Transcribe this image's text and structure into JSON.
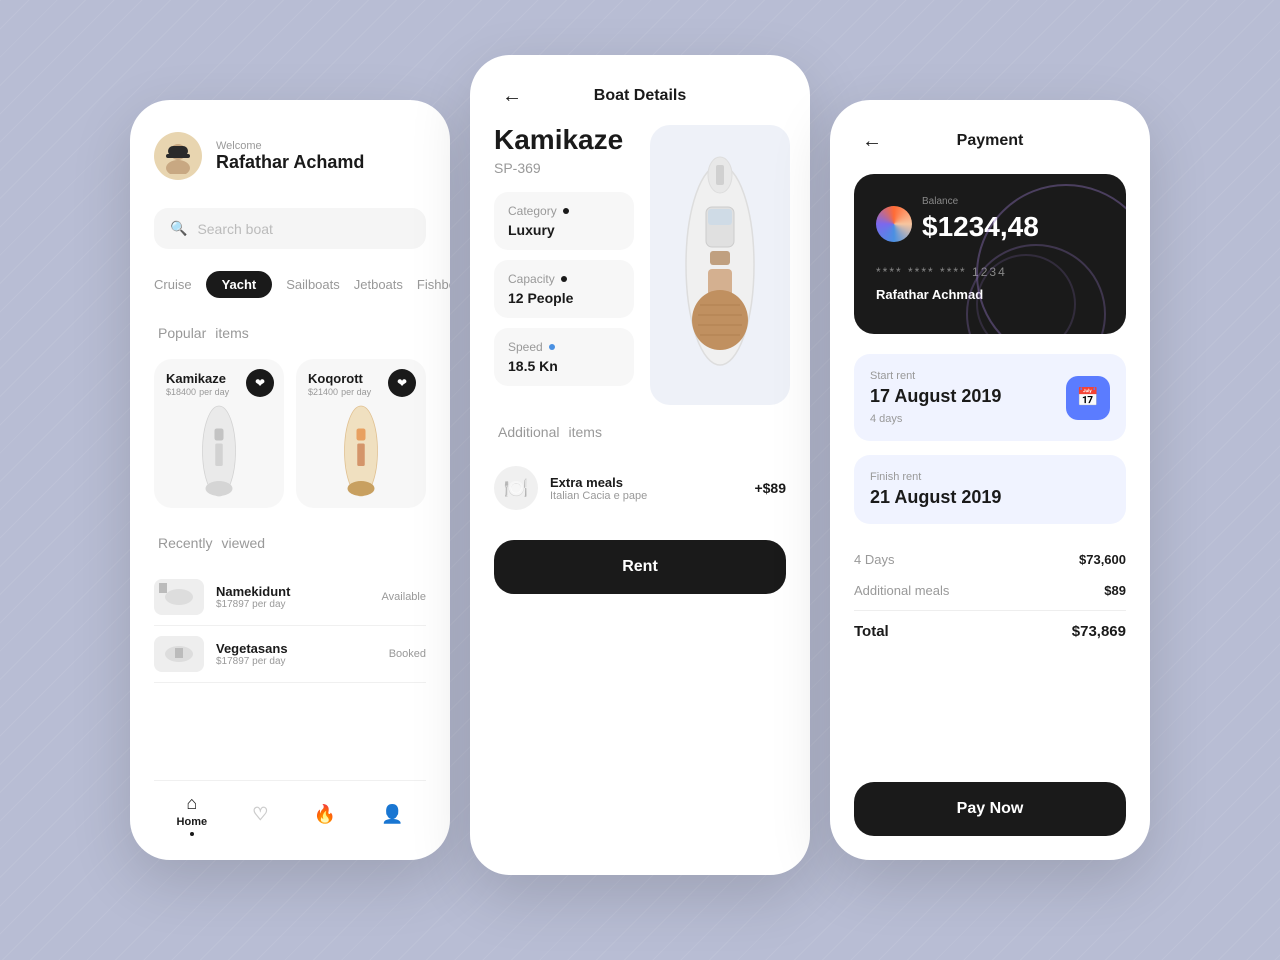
{
  "background": {
    "color": "#b8bdd4"
  },
  "screen1": {
    "header": {
      "welcome_label": "Welcome",
      "user_name": "Rafathar Achamd"
    },
    "search": {
      "placeholder": "Search boat"
    },
    "tabs": [
      {
        "label": "Cruise",
        "active": false
      },
      {
        "label": "Yacht",
        "active": true
      },
      {
        "label": "Sailboats",
        "active": false
      },
      {
        "label": "Jetboats",
        "active": false
      },
      {
        "label": "Fishbo...",
        "active": false
      }
    ],
    "popular_section": {
      "title": "Popular",
      "subtitle": "items"
    },
    "popular_items": [
      {
        "name": "Kamikaze",
        "price": "$18400",
        "per": "per day"
      },
      {
        "name": "Koqorott",
        "price": "$21400",
        "per": "per day"
      }
    ],
    "recently_section": {
      "title": "Recently",
      "subtitle": "viewed"
    },
    "recent_items": [
      {
        "name": "Namekidunt",
        "price": "$17897",
        "per": "per day",
        "status": "Available"
      },
      {
        "name": "Vegetasans",
        "price": "$17897",
        "per": "per day",
        "status": "Booked"
      }
    ],
    "nav": [
      {
        "label": "Home",
        "icon": "🏠",
        "active": true
      },
      {
        "label": "",
        "icon": "♡",
        "active": false
      },
      {
        "label": "",
        "icon": "🔥",
        "active": false
      },
      {
        "label": "",
        "icon": "👤",
        "active": false
      }
    ]
  },
  "screen2": {
    "header": {
      "title": "Boat Details"
    },
    "boat": {
      "name": "Kamikaze",
      "model": "SP-369"
    },
    "specs": [
      {
        "label": "Category",
        "dot_color": "dark",
        "value": "Luxury"
      },
      {
        "label": "Capacity",
        "dot_color": "dark",
        "value": "12 People"
      },
      {
        "label": "Speed",
        "dot_color": "blue",
        "value": "18.5 Kn"
      }
    ],
    "additional_section": {
      "title": "Additional",
      "subtitle": "items"
    },
    "additional_items": [
      {
        "name": "Extra meals",
        "description": "Italian Cacia e pape",
        "price": "+$89",
        "icon": "🍽️"
      }
    ],
    "rent_button": "Rent"
  },
  "screen3": {
    "header": {
      "title": "Payment"
    },
    "card": {
      "balance_label": "Balance",
      "balance": "$1234,48",
      "number": "**** **** **** 1234",
      "holder": "Rafathar Achmad"
    },
    "start_rent": {
      "label": "Start rent",
      "date": "17 August 2019",
      "days": "4 days"
    },
    "finish_rent": {
      "label": "Finish rent",
      "date": "21 August 2019"
    },
    "pricing": {
      "days_label": "4 Days",
      "days_amount": "$73,600",
      "meals_label": "Additional meals",
      "meals_amount": "$89",
      "total_label": "Total",
      "total_amount": "$73,869"
    },
    "pay_button": "Pay Now"
  }
}
